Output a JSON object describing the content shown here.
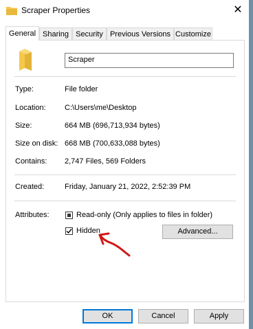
{
  "window": {
    "title": "Scraper Properties",
    "close_glyph": "✕"
  },
  "tabs": [
    {
      "label": "General"
    },
    {
      "label": "Sharing"
    },
    {
      "label": "Security"
    },
    {
      "label": "Previous Versions"
    },
    {
      "label": "Customize"
    }
  ],
  "general": {
    "name_value": "Scraper",
    "type_label": "Type:",
    "type_value": "File folder",
    "location_label": "Location:",
    "location_value": "C:\\Users\\me\\Desktop",
    "size_label": "Size:",
    "size_value": "664 MB (696,713,934 bytes)",
    "size_on_disk_label": "Size on disk:",
    "size_on_disk_value": "668 MB (700,633,088 bytes)",
    "contains_label": "Contains:",
    "contains_value": "2,747 Files, 569 Folders",
    "created_label": "Created:",
    "created_value": "Friday, January 21, 2022, 2:52:39 PM",
    "attributes_label": "Attributes:",
    "readonly_label": "Read-only (Only applies to files in folder)",
    "readonly_state": "indeterminate",
    "hidden_label": "Hidden",
    "hidden_state": "checked",
    "advanced_label": "Advanced..."
  },
  "footer": {
    "ok_label": "OK",
    "cancel_label": "Cancel",
    "apply_label": "Apply"
  },
  "colors": {
    "annotation": "#d01919",
    "accent": "#0078d7",
    "folder": "#f5c84c"
  }
}
